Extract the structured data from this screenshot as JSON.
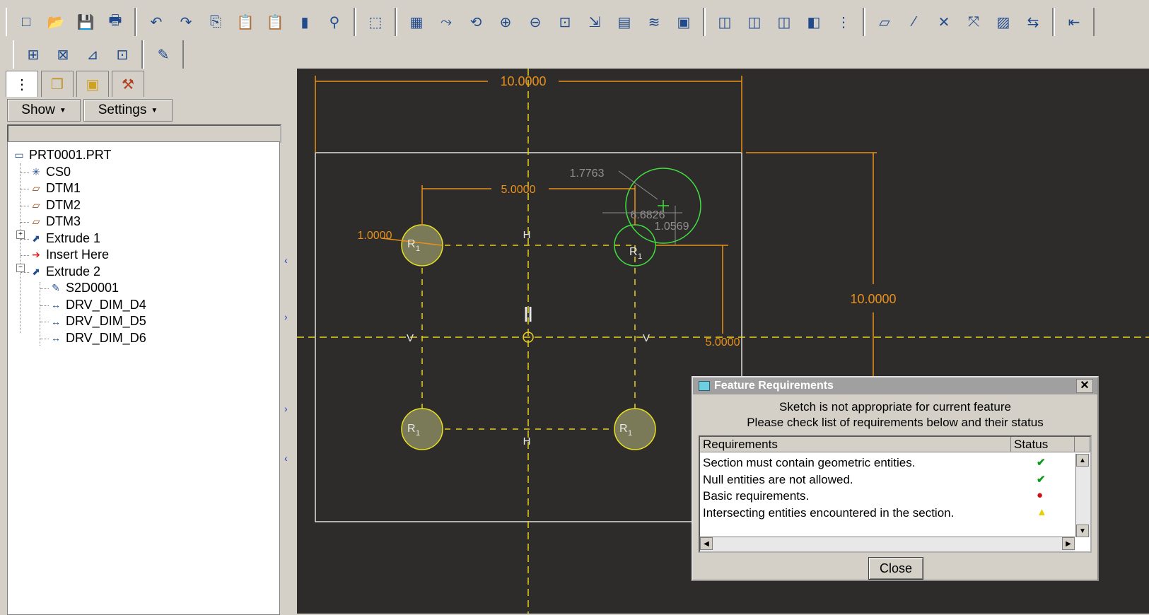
{
  "toolbar": {
    "row1": [
      {
        "name": "new-icon",
        "glyph": "□"
      },
      {
        "name": "open-icon",
        "glyph": "📂"
      },
      {
        "name": "save-icon",
        "glyph": "💾"
      },
      {
        "name": "print-icon",
        "glyph": "🖶"
      },
      {
        "name": "undo-icon",
        "glyph": "↶"
      },
      {
        "name": "redo-icon",
        "glyph": "↷"
      },
      {
        "name": "copy-icon",
        "glyph": "⎘"
      },
      {
        "name": "paste-icon",
        "glyph": "📋"
      },
      {
        "name": "paste-special-icon",
        "glyph": "📋"
      },
      {
        "name": "regenerate-icon",
        "glyph": "▮"
      },
      {
        "name": "find-icon",
        "glyph": "⚲"
      },
      {
        "name": "selection-box-icon",
        "glyph": "⬚"
      },
      {
        "name": "sketch-view-icon",
        "glyph": "▦"
      },
      {
        "name": "spin-center-icon",
        "glyph": "⤳"
      },
      {
        "name": "orient-icon",
        "glyph": "⟲"
      },
      {
        "name": "zoom-in-icon",
        "glyph": "⊕"
      },
      {
        "name": "zoom-out-icon",
        "glyph": "⊖"
      },
      {
        "name": "refit-icon",
        "glyph": "⊡"
      },
      {
        "name": "reorient-icon",
        "glyph": "⇲"
      },
      {
        "name": "saved-views-icon",
        "glyph": "▤"
      },
      {
        "name": "layers-icon",
        "glyph": "≋"
      },
      {
        "name": "view-manager-icon",
        "glyph": "▣"
      },
      {
        "name": "wireframe-icon",
        "glyph": "◫"
      },
      {
        "name": "hidden-line-icon",
        "glyph": "◫"
      },
      {
        "name": "no-hidden-icon",
        "glyph": "◫"
      },
      {
        "name": "shading-icon",
        "glyph": "◧"
      },
      {
        "name": "model-tree-icon",
        "glyph": "⋮"
      },
      {
        "name": "datum-planes-icon",
        "glyph": "▱"
      },
      {
        "name": "datum-axes-icon",
        "glyph": "⁄"
      },
      {
        "name": "datum-points-icon",
        "glyph": "✕"
      },
      {
        "name": "coordinate-systems-icon",
        "glyph": "⤧"
      },
      {
        "name": "annotation-icon",
        "glyph": "▨"
      },
      {
        "name": "window-icon",
        "glyph": "⇆"
      },
      {
        "name": "context-help-icon",
        "glyph": "⇤"
      }
    ],
    "row2": [
      {
        "name": "dimension-display-icon",
        "glyph": "⊞"
      },
      {
        "name": "constraints-display-icon",
        "glyph": "⊠"
      },
      {
        "name": "grid-display-icon",
        "glyph": "⊿"
      },
      {
        "name": "vertices-display-icon",
        "glyph": "⊡"
      },
      {
        "name": "sketch-diagnostics-icon",
        "glyph": "✎"
      }
    ]
  },
  "panel": {
    "tabs": [
      "model-tree-tab-icon",
      "layer-tree-tab-icon",
      "folder-browser-tab-icon",
      "favorites-tab-icon"
    ],
    "show_label": "Show",
    "settings_label": "Settings"
  },
  "tree": [
    {
      "label": "PRT0001.PRT",
      "icon": "part-icon",
      "glyph": "▭",
      "indent": 0
    },
    {
      "label": "CS0",
      "icon": "csys-icon",
      "glyph": "✳",
      "indent": 1
    },
    {
      "label": "DTM1",
      "icon": "datum-plane-icon",
      "glyph": "▱",
      "indent": 1
    },
    {
      "label": "DTM2",
      "icon": "datum-plane-icon",
      "glyph": "▱",
      "indent": 1
    },
    {
      "label": "DTM3",
      "icon": "datum-plane-icon",
      "glyph": "▱",
      "indent": 1
    },
    {
      "label": "Extrude 1",
      "icon": "extrude-icon",
      "glyph": "⬈",
      "indent": 1
    },
    {
      "label": "Insert Here",
      "icon": "insert-arrow-icon",
      "glyph": "➔",
      "indent": 1
    },
    {
      "label": "Extrude 2",
      "icon": "extrude-icon",
      "glyph": "⬈",
      "indent": 1
    },
    {
      "label": "S2D0001",
      "icon": "sketch-icon",
      "glyph": "✎",
      "indent": 2
    },
    {
      "label": "DRV_DIM_D4",
      "icon": "dimension-icon",
      "glyph": "↔",
      "indent": 2
    },
    {
      "label": "DRV_DIM_D5",
      "icon": "dimension-icon",
      "glyph": "↔",
      "indent": 2
    },
    {
      "label": "DRV_DIM_D6",
      "icon": "dimension-icon",
      "glyph": "↔",
      "indent": 2
    }
  ],
  "sketch": {
    "dim_width": "10.0000",
    "dim_height": "10.0000",
    "dim_spacing_h": "5.0000",
    "dim_spacing_v": "5.0000",
    "dim_diameter": "1.0000",
    "dim_weak_1": "1.7763",
    "dim_weak_2": "6.6826",
    "dim_weak_3": "1.0569",
    "label_h": "H",
    "label_v": "V",
    "label_r": "R",
    "label_r_sub": "1",
    "label_equal": "||"
  },
  "dialog": {
    "title": "Feature Requirements",
    "msg1": "Sketch is not appropriate for current feature",
    "msg2": "Please check list of requirements below and their status",
    "col_requirements": "Requirements",
    "col_status": "Status",
    "rows": [
      {
        "text": "Section must contain geometric entities.",
        "status": "✔",
        "color": "#0a9a1a",
        "icon": "check-icon"
      },
      {
        "text": "Null entities are not allowed.",
        "status": "✔",
        "color": "#0a9a1a",
        "icon": "check-icon"
      },
      {
        "text": "Basic requirements.",
        "status": "●",
        "color": "#d01010",
        "icon": "error-icon"
      },
      {
        "text": "Intersecting entities encountered in the section.",
        "status": "▲",
        "color": "#e8d000",
        "icon": "warning-icon"
      }
    ],
    "close_label": "Close"
  }
}
